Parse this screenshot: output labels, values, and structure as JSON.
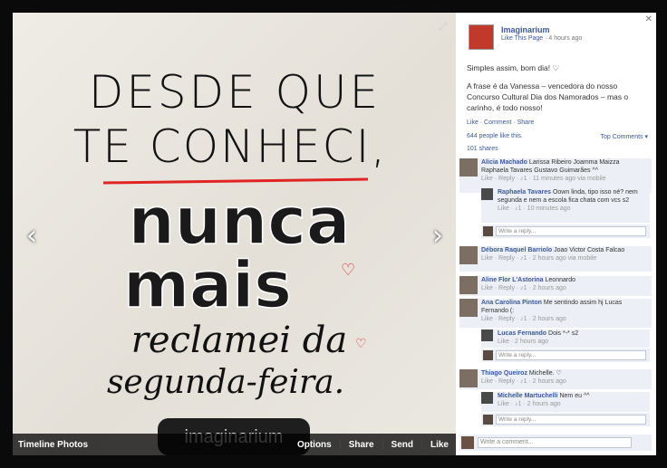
{
  "photo": {
    "text_lines": [
      "DESDE QUE",
      "TE CONHECI,",
      "nunca",
      "mais",
      "reclamei da",
      "segunda-feira."
    ],
    "brand": "imaginarium"
  },
  "bar": {
    "title": "Timeline Photos",
    "actions": [
      "Options",
      "Share",
      "Send",
      "Like"
    ]
  },
  "page": {
    "name": "Imaginarium",
    "like_link": "Like This Page",
    "time": "· 4 hours ago"
  },
  "caption": {
    "line1": "Simples assim, bom dia! ♡",
    "line2": "A frase é da Vanessa – vencedora do nosso Concurso Cultural Dia dos Namorados – mas o carinho, é todo nosso!"
  },
  "actions_line": "Like · Comment · Share",
  "likes": "644 people like this.",
  "top_comments": "Top Comments ▾",
  "shares": "101 shares",
  "comments": [
    {
      "name": "Alicia Machado",
      "text": "Larissa Ribeiro Joamma Maizza Raphaela Tavares Gustavo Guimarães ^^",
      "meta": "Like · Reply · ♪1 · 11 minutes ago via mobile"
    },
    {
      "name": "Raphaela Tavares",
      "text": "Oown linda, tipo isso né? nem segunda e nem a escola fica chata com vcs s2",
      "meta": "Like · ♪1 · 10 minutes ago"
    },
    {
      "name": "Débora Raquel Barriolo",
      "text": "Joao Victor Costa Falcao",
      "meta": "Like · Reply · ♪1 · 2 hours ago via mobile"
    },
    {
      "name": "Aline Flor L'Astorina",
      "text": "Leonnardo",
      "meta": "Like · Reply · ♪1 · 2 hours ago"
    },
    {
      "name": "Ana Carolina Pinton",
      "text": "Me sentindo assim hj Lucas Fernando (:",
      "meta": "Like · Reply · ♪1 · 2 hours ago"
    },
    {
      "name": "Lucas Fernando",
      "text": "Dois *-* s2",
      "meta": "Like · 2 hours ago"
    },
    {
      "name": "Thiago Queiroz",
      "text": "Michelle. ♡",
      "meta": "Like · Reply · ♪1 · 2 hours ago"
    },
    {
      "name": "Michelle Martuchelli",
      "text": "Nem eu ^^",
      "meta": "Like · ♪1 · 2 hours ago"
    }
  ],
  "reply_placeholder": "Write a reply...",
  "comment_placeholder": "Write a comment...",
  "colors": {
    "link": "#3b5998",
    "heart": "#e23131"
  }
}
